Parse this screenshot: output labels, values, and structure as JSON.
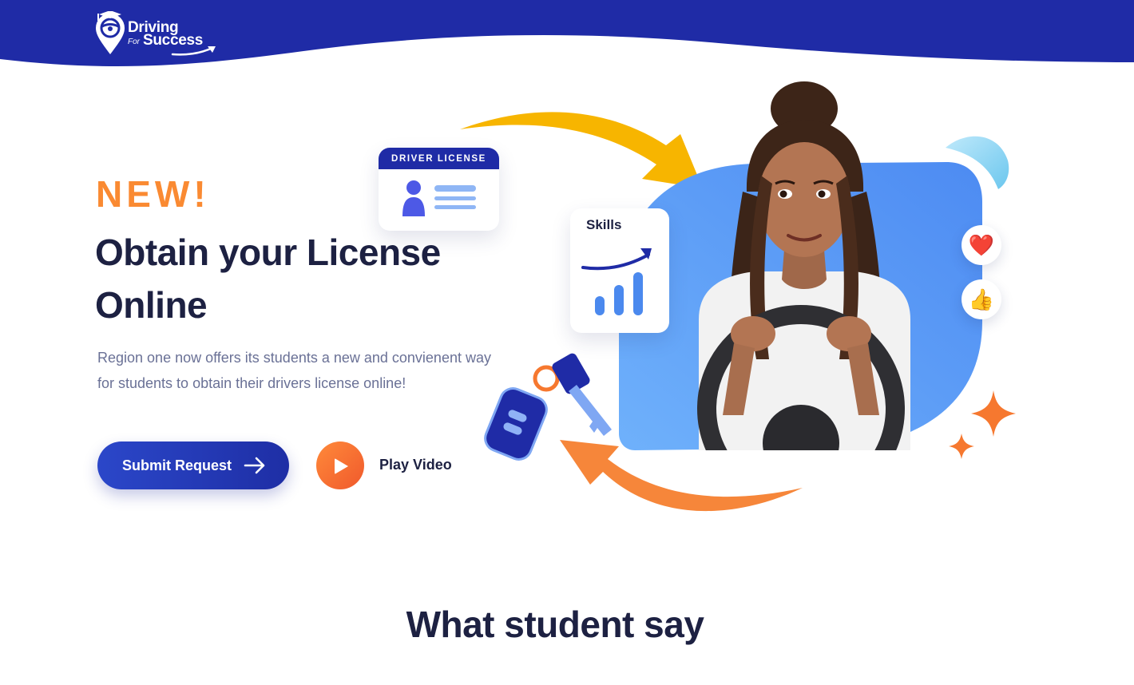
{
  "brand": {
    "line1": "Driving",
    "for": "For",
    "line2": "Success"
  },
  "hero": {
    "badge": "NEW!",
    "title": "Obtain your License Online",
    "description": "Region one now offers its students a new and convienent way for students to obtain their drivers license online!",
    "submit_label": "Submit Request",
    "play_label": "Play Video"
  },
  "cards": {
    "license_title": "DRIVER LICENSE",
    "skills_title": "Skills"
  },
  "reactions": {
    "heart": "❤️",
    "thumb": "👍"
  },
  "testimonials": {
    "heading": "What student say"
  },
  "icons": [
    "steering-wheel-pin-icon",
    "arrow-right-icon",
    "play-icon",
    "person-icon",
    "chart-icon",
    "heart-icon",
    "thumbs-up-icon",
    "car-key-icon",
    "sparkle-icon"
  ],
  "colors": {
    "brand_blue": "#1f2ba6",
    "accent_orange": "#fa8a32",
    "accent_yellow": "#f7b500",
    "blob_blue": "#5a9bf6",
    "text_dark": "#1d2142",
    "text_muted": "#6a7196"
  }
}
